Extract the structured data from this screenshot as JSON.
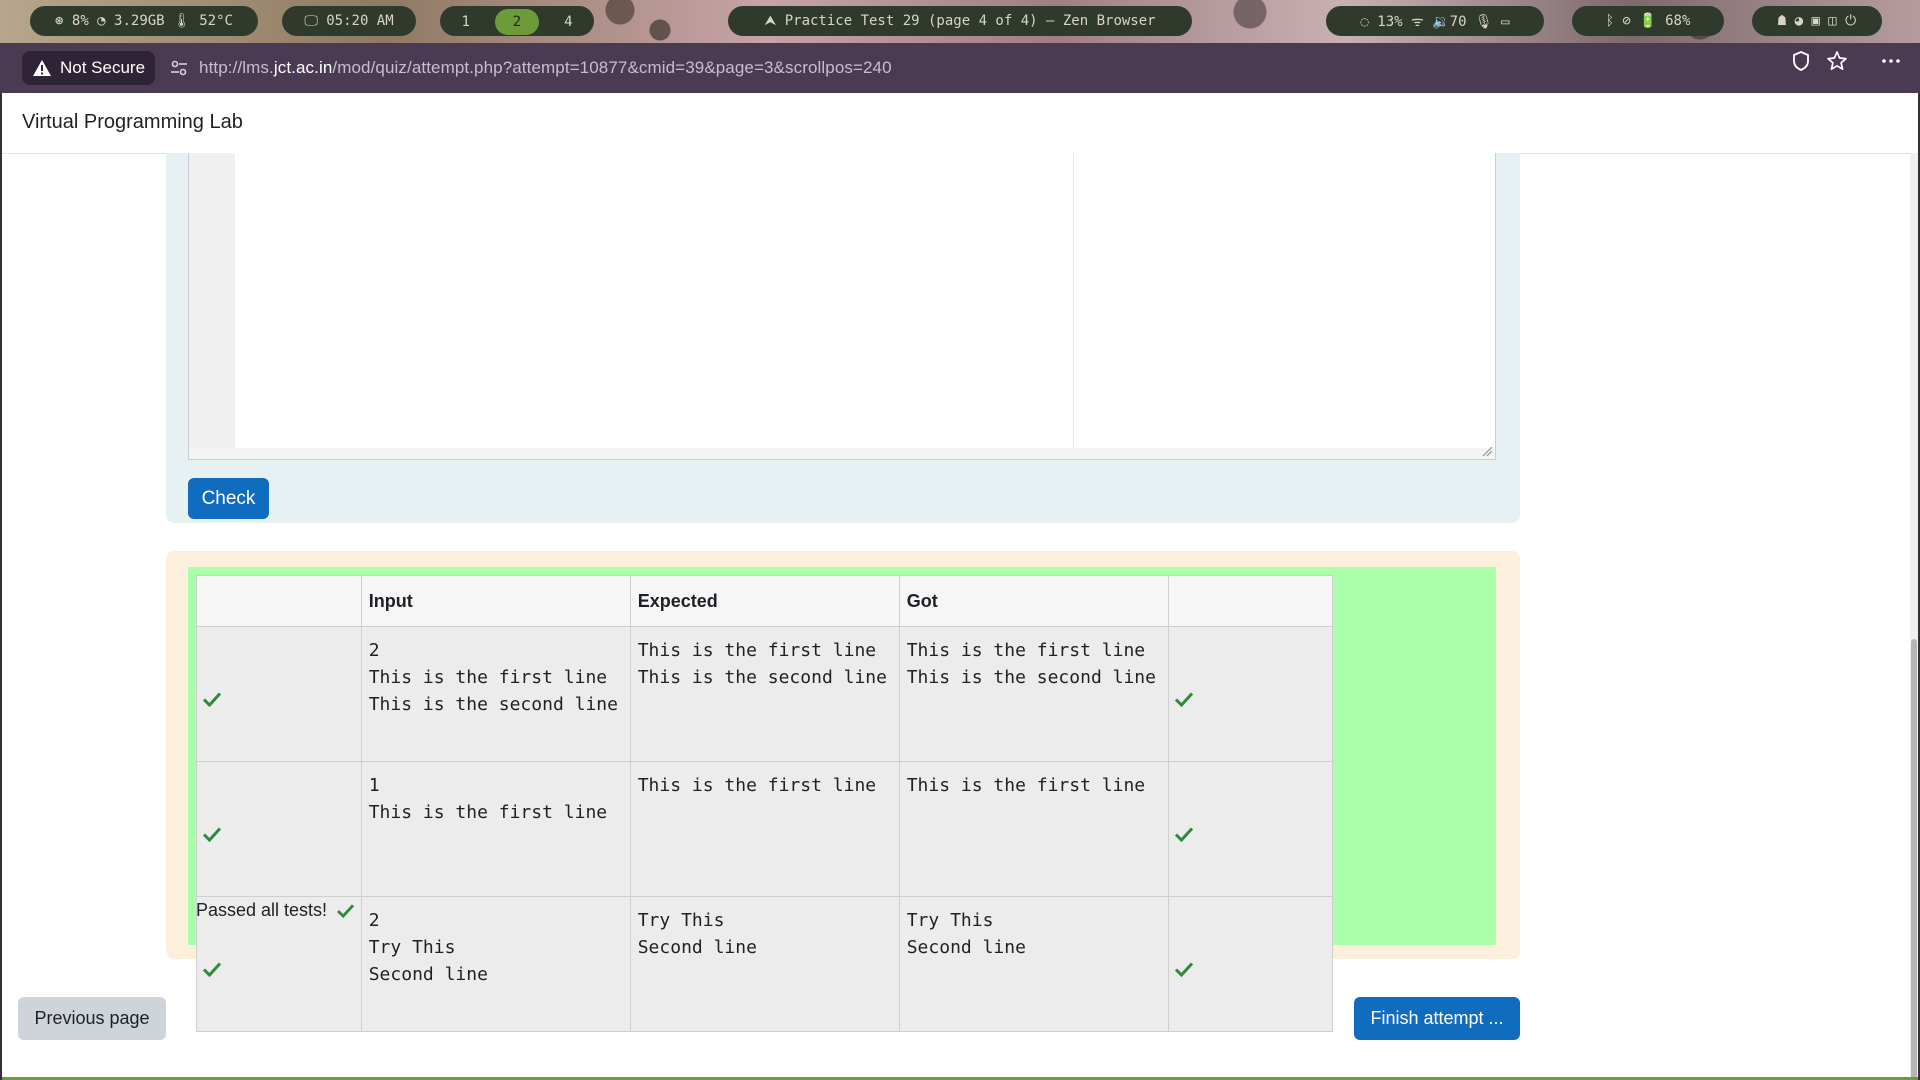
{
  "system_bar": {
    "stats": "⊛ 8%  ◔ 3.29GB  🌡 52°C",
    "clock": "🖵 05:20 AM",
    "workspaces": [
      "1",
      "2",
      "4"
    ],
    "active_workspace": "2",
    "window_title": "⮝ Practice Test 29 (page 4 of 4) — Zen Browser",
    "status": "◌ 13%   ᯤ  🔉70  🎙  ▭",
    "battery": "ᛒ  ⊘  🔋 68%",
    "power_icons": "☗ ◕ ▣ ◫ ⏻"
  },
  "browser": {
    "not_secure_label": "Not Secure",
    "url_prefix": "http://lms.",
    "url_domain": "jct.ac.in",
    "url_path": "/mod/quiz/attempt.php?attempt=10877&cmid=39&page=3&scrollpos=240"
  },
  "site": {
    "title": "Virtual Programming Lab"
  },
  "question": {
    "check_label": "Check"
  },
  "results": {
    "headers": [
      "Input",
      "Expected",
      "Got"
    ],
    "rows": [
      {
        "input": "2\nThis is the first line\nThis is the second line",
        "expected": "This is the first line\nThis is the second line",
        "got": "This is the first line\nThis is the second line"
      },
      {
        "input": "1\nThis is the first line",
        "expected": "This is the first line",
        "got": "This is the first line"
      },
      {
        "input": "2\nTry This\nSecond line",
        "expected": "Try This\nSecond line",
        "got": "Try This\nSecond line"
      }
    ],
    "summary": "Passed all tests!"
  },
  "navigation": {
    "previous_label": "Previous page",
    "finish_label": "Finish attempt ..."
  },
  "colors": {
    "primary": "#0f6cbf",
    "pass_green": "#aaffaa",
    "tick_green": "#2e8b3a"
  }
}
